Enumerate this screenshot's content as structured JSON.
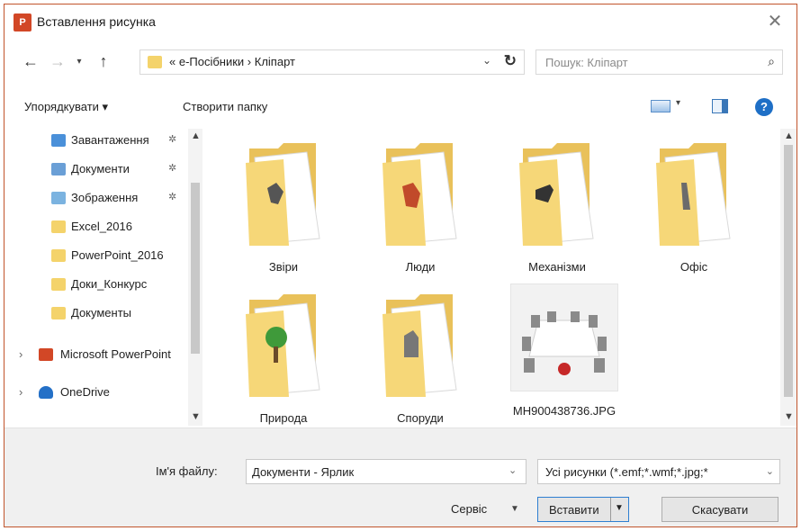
{
  "title": "Вставлення рисунка",
  "app_icon_text": "P",
  "address": {
    "path": "« e-Посібники › Кліпарт",
    "search_placeholder": "Пошук: Кліпарт"
  },
  "toolbar": {
    "organize_label": "Упорядкувати ▾",
    "new_folder_label": "Створити папку"
  },
  "nav": {
    "items": [
      {
        "label": "Завантаження",
        "pinned": true
      },
      {
        "label": "Документи",
        "pinned": true
      },
      {
        "label": "Зображення",
        "pinned": true
      },
      {
        "label": "Excel_2016"
      },
      {
        "label": "PowerPoint_2016"
      },
      {
        "label": "Доки_Конкурс"
      },
      {
        "label": "Документы"
      },
      {
        "label": "Microsoft PowerPoint"
      },
      {
        "label": "OneDrive"
      }
    ]
  },
  "content": {
    "items": [
      {
        "label": "Звіри",
        "type": "folder"
      },
      {
        "label": "Люди",
        "type": "folder"
      },
      {
        "label": "Механізми",
        "type": "folder"
      },
      {
        "label": "Офіс",
        "type": "folder"
      },
      {
        "label": "Природа",
        "type": "folder"
      },
      {
        "label": "Споруди",
        "type": "folder"
      },
      {
        "label": "MH900438736.JPG",
        "type": "image"
      }
    ]
  },
  "bottom": {
    "filename_label": "Ім'я файлу:",
    "filename_value": "Документи - Ярлик",
    "filter_value": "Усі рисунки (*.emf;*.wmf;*.jpg;*",
    "tools_label": "Сервіс",
    "insert_label": "Вставити",
    "cancel_label": "Скасувати"
  },
  "colors": {
    "window_border": "#c1542c",
    "folder_yellow": "#f4d36b",
    "accent_blue": "#2e7fd1"
  }
}
